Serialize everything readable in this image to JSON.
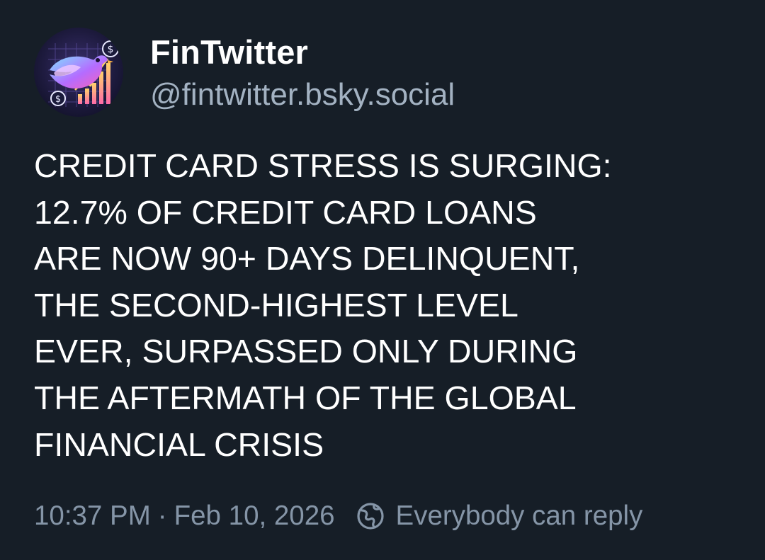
{
  "author": {
    "display_name": "FinTwitter",
    "handle": "@fintwitter.bsky.social",
    "avatar_icon": "bird-finance-avatar-icon"
  },
  "post": {
    "lines": [
      "CREDIT CARD STRESS IS SURGING:",
      "12.7% OF CREDIT CARD LOANS",
      "ARE NOW 90+ DAYS DELINQUENT,",
      "THE SECOND-HIGHEST LEVEL",
      "EVER, SURPASSED ONLY DURING",
      "THE AFTERMATH OF THE GLOBAL",
      "FINANCIAL CRISIS"
    ]
  },
  "meta": {
    "timestamp": "10:37 PM",
    "separator": "·",
    "date": "Feb 10, 2026",
    "reply_icon": "globe-icon",
    "reply_setting": "Everybody can reply"
  },
  "colors": {
    "background": "#161e27",
    "text": "#ffffff",
    "handle": "#a3b2c2",
    "meta": "#8595a7"
  }
}
